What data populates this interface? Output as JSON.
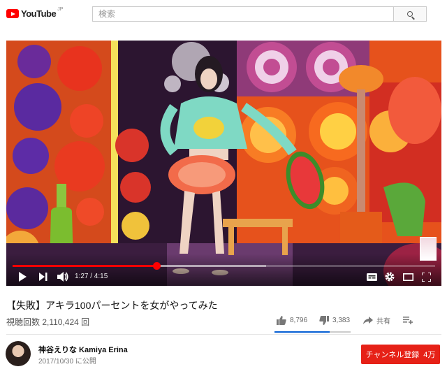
{
  "masthead": {
    "logo_text": "YouTube",
    "logo_region": "JP",
    "search_placeholder": "検索"
  },
  "player": {
    "current_time": "1:27",
    "duration": "4:15",
    "time_display": "1:27 / 4:15",
    "progress_fraction": 0.341,
    "buffered_fraction": 0.6,
    "accent_color": "#ff0000",
    "icons": [
      "play-icon",
      "next-icon",
      "volume-icon",
      "captions-icon",
      "settings-icon",
      "miniplayer-icon",
      "fullscreen-icon"
    ]
  },
  "video": {
    "title": "【失敗】アキラ100パーセントを女がやってみた",
    "views": "視聴回数 2,110,424 回",
    "likes": "8,796",
    "dislikes": "3,383",
    "share_label": "共有",
    "like_fraction": 0.722
  },
  "channel": {
    "name": "神谷えりな Kamiya Erina",
    "published": "2017/10/30 に公開",
    "subscribe_label": "チャンネル登録",
    "subscriber_count": "4万",
    "subscribe_color": "#e62117"
  }
}
